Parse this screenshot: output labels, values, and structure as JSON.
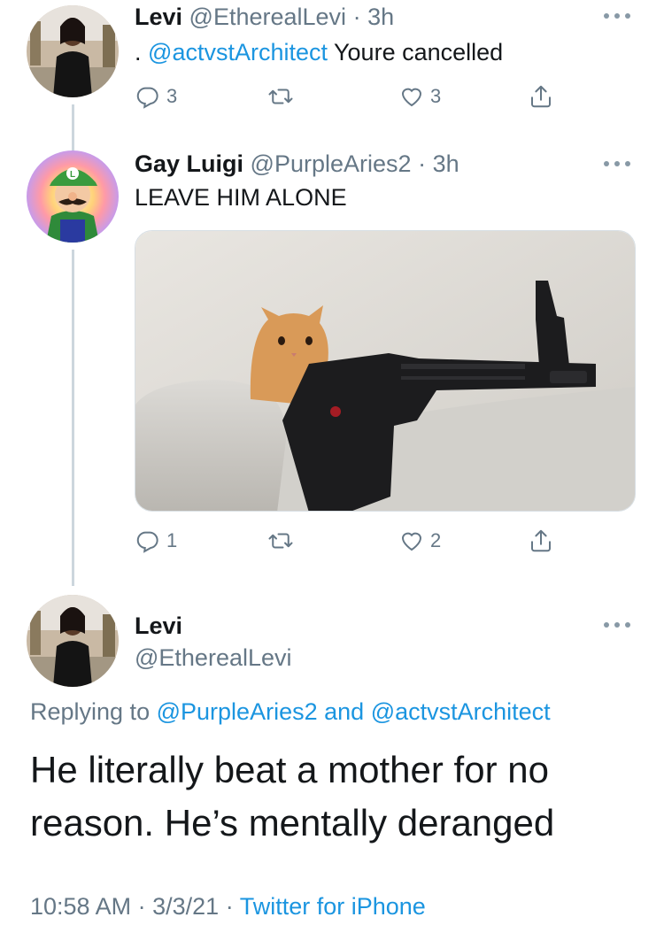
{
  "tweet1": {
    "name": "Levi",
    "handle": "@EtherealLevi",
    "sep": "·",
    "time": "3h",
    "text_prefix": ".",
    "mention": "@actvstArchitect",
    "text_rest": "Youre cancelled",
    "reply_count": "3",
    "retweet_count": "",
    "like_count": "3",
    "avatar_icon": "person-avatar-icon"
  },
  "tweet2": {
    "name": "Gay Luigi",
    "handle": "@PurpleAries2",
    "sep": "·",
    "time": "3h",
    "text": "LEAVE HIM ALONE",
    "reply_count": "1",
    "retweet_count": "",
    "like_count": "2",
    "media_description_icon": "kitten-with-rifle-image",
    "avatar_icon": "luigi-avatar-icon"
  },
  "main_tweet": {
    "name": "Levi",
    "handle": "@EtherealLevi",
    "replying_label": "Replying to",
    "reply_mention_1": "@PurpleAries2",
    "reply_and": "and",
    "reply_mention_2": "@actvstArchitect",
    "text": "He literally beat a mother for no reason. He’s mentally deranged",
    "time": "10:58 AM",
    "sep": "·",
    "date": "3/3/21",
    "source": "Twitter for iPhone"
  },
  "colors": {
    "link": "#1b95e0",
    "muted": "#657786",
    "thread_line": "#ccd6dd"
  }
}
